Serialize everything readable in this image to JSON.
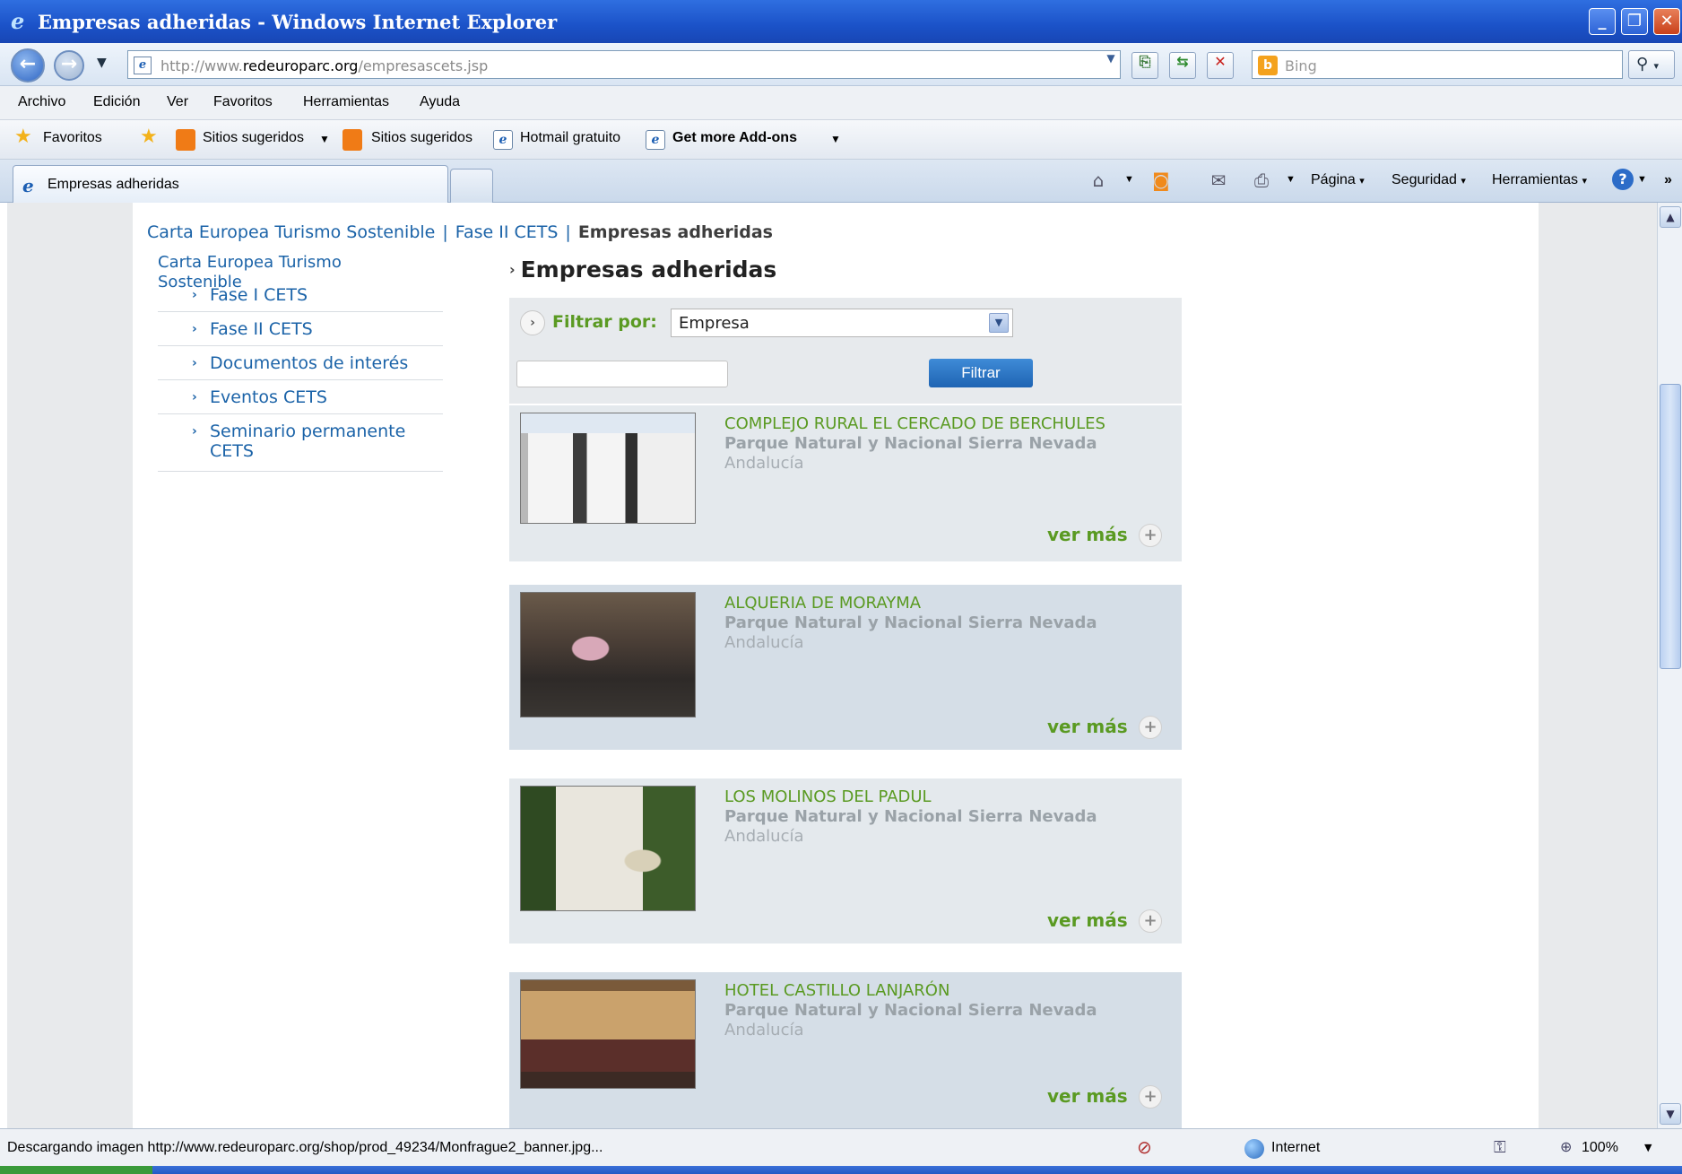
{
  "window": {
    "title": "Empresas adheridas - Windows Internet Explorer",
    "controls": [
      "minimize-icon",
      "restore-icon",
      "close-icon"
    ]
  },
  "address": {
    "url_prefix": "http://www.",
    "url_domain": "redeuroparc.org",
    "url_path": "/empresascets.jsp",
    "search_placeholder": "Bing"
  },
  "menu": [
    "Archivo",
    "Edición",
    "Ver",
    "Favoritos",
    "Herramientas",
    "Ayuda"
  ],
  "favorites_bar": {
    "favorites_label": "Favoritos",
    "items": [
      "Sitios sugeridos",
      "Sitios sugeridos",
      "Hotmail gratuito",
      "Get more Add-ons"
    ]
  },
  "tab": {
    "label": "Empresas adheridas"
  },
  "command_bar": {
    "page": "Página",
    "security": "Seguridad",
    "tools": "Herramientas"
  },
  "breadcrumb": [
    "Carta Europea Turismo Sostenible",
    "Fase II CETS",
    "Empresas adheridas"
  ],
  "sidebar": {
    "title": "Carta Europea Turismo Sostenible",
    "items": [
      "Fase I CETS",
      "Fase II CETS",
      "Documentos de interés",
      "Eventos CETS",
      "Seminario permanente CETS"
    ]
  },
  "main": {
    "title": "Empresas adheridas",
    "filter_label": "Filtrar por:",
    "filter_select_value": "Empresa",
    "filter_button": "Filtrar",
    "more_label": "ver más"
  },
  "companies": [
    {
      "name": "COMPLEJO RURAL EL CERCADO DE BERCHULES",
      "park": "Parque Natural y Nacional Sierra Nevada",
      "region": "Andalucía"
    },
    {
      "name": "ALQUERIA DE MORAYMA",
      "park": "Parque Natural y Nacional Sierra Nevada",
      "region": "Andalucía"
    },
    {
      "name": "LOS MOLINOS DEL PADUL",
      "park": "Parque Natural y Nacional Sierra Nevada",
      "region": "Andalucía"
    },
    {
      "name": "HOTEL CASTILLO LANJARÓN",
      "park": "Parque Natural y Nacional Sierra Nevada",
      "region": "Andalucía"
    }
  ],
  "status": {
    "text": "Descargando imagen http://www.redeuroparc.org/shop/prod_49234/Monfrague2_banner.jpg...",
    "zone": "Internet",
    "zoom": "100%"
  },
  "colors": {
    "link_blue": "#1b63a8",
    "accent_green": "#5a9a22",
    "titlebar_blue": "#1b52c8"
  }
}
